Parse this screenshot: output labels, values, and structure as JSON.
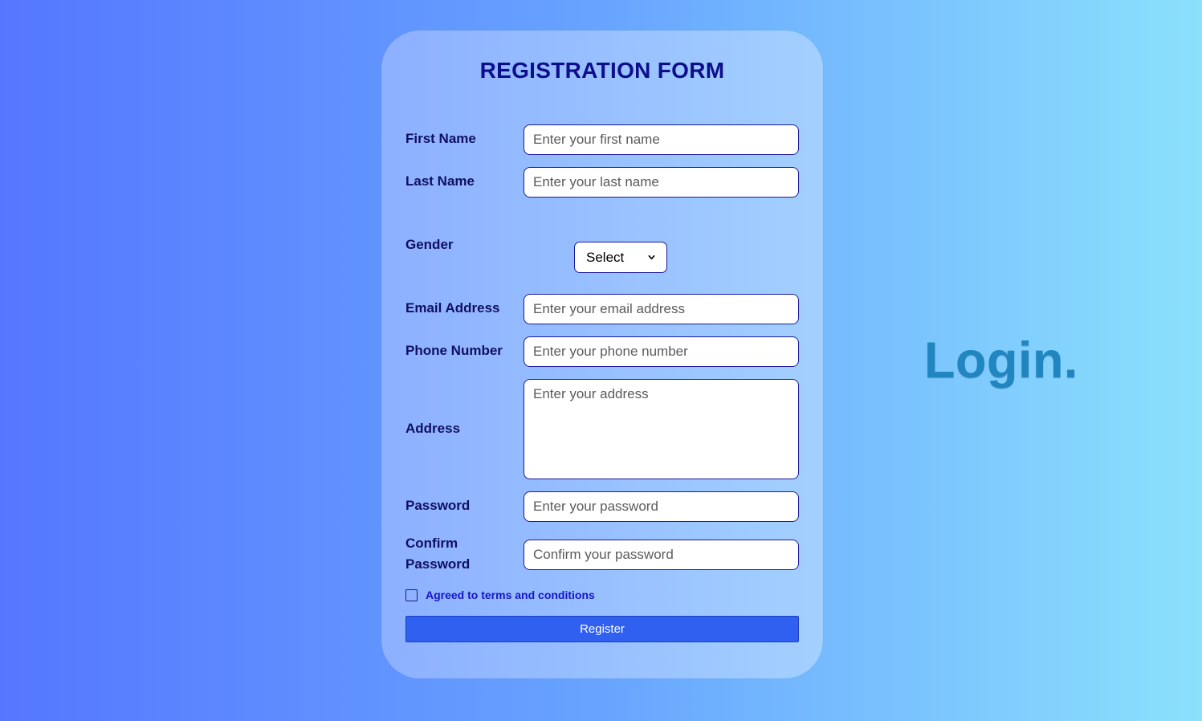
{
  "form": {
    "title": "REGISTRATION FORM",
    "first_name": {
      "label": "First Name",
      "placeholder": "Enter your first name"
    },
    "last_name": {
      "label": "Last Name",
      "placeholder": "Enter your last name"
    },
    "gender": {
      "label": "Gender",
      "selected": "Select"
    },
    "email": {
      "label": "Email Address",
      "placeholder": "Enter your email address"
    },
    "phone": {
      "label": "Phone Number",
      "placeholder": "Enter your phone number"
    },
    "address": {
      "label": "Address",
      "placeholder": "Enter your address"
    },
    "password": {
      "label": "Password",
      "placeholder": "Enter your password"
    },
    "confirm_password": {
      "label_line1": "Confirm",
      "label_line2": "Password",
      "placeholder": "Confirm your password"
    },
    "terms_label": "Agreed to terms and conditions",
    "register_label": "Register"
  },
  "side": {
    "login_text": "Login."
  },
  "colors": {
    "title": "#0e0e8c",
    "label": "#101060",
    "button": "#2f60ef",
    "login": "#2185c0"
  },
  "icons": {
    "select_arrow": "chevron-down-icon"
  }
}
